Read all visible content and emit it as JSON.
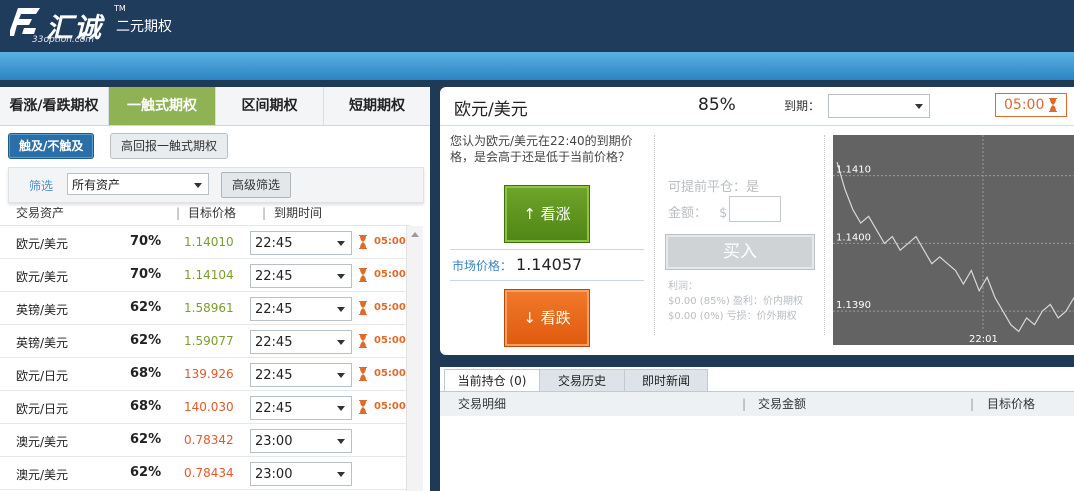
{
  "header": {
    "brand": "汇诚",
    "tm": "TM",
    "sub": "二元期权",
    "url": "33option.com"
  },
  "tabs": [
    "看涨/看跌期权",
    "一触式期权",
    "区间期权",
    "短期期权"
  ],
  "pills": {
    "active": "触及/不触及",
    "other": "高回报一触式期权"
  },
  "filter": {
    "label": "筛选",
    "value": "所有资产",
    "adv": "高级筛选"
  },
  "columns": {
    "asset": "交易资产",
    "target": "目标价格",
    "expiry": "到期时间"
  },
  "rows": [
    {
      "asset": "欧元/美元",
      "pct": "70%",
      "target": "1.14010",
      "color": "#7a9e2e",
      "time": "22:45",
      "countdown": "05:00"
    },
    {
      "asset": "欧元/美元",
      "pct": "70%",
      "target": "1.14104",
      "color": "#7a9e2e",
      "time": "22:45",
      "countdown": "05:00"
    },
    {
      "asset": "英镑/美元",
      "pct": "62%",
      "target": "1.58961",
      "color": "#7a9e2e",
      "time": "22:45",
      "countdown": "05:00"
    },
    {
      "asset": "英镑/美元",
      "pct": "62%",
      "target": "1.59077",
      "color": "#7a9e2e",
      "time": "22:45",
      "countdown": "05:00"
    },
    {
      "asset": "欧元/日元",
      "pct": "68%",
      "target": "139.926",
      "color": "#e0592a",
      "time": "22:45",
      "countdown": "05:00"
    },
    {
      "asset": "欧元/日元",
      "pct": "68%",
      "target": "140.030",
      "color": "#e0592a",
      "time": "22:45",
      "countdown": "05:00"
    },
    {
      "asset": "澳元/美元",
      "pct": "62%",
      "target": "0.78342",
      "color": "#e0592a",
      "time": "23:00",
      "countdown": ""
    },
    {
      "asset": "澳元/美元",
      "pct": "62%",
      "target": "0.78434",
      "color": "#e0592a",
      "time": "23:00",
      "countdown": ""
    }
  ],
  "trade": {
    "pair": "欧元/美元",
    "payout": "85%",
    "expiry_label": "到期：",
    "expiry_value": "",
    "timer": "05:00",
    "question": "您认为欧元/美元在22:40的到期价格，是会高于还是低于当前价格？",
    "up": "↑ 看涨",
    "down": "↓ 看跌",
    "market_label": "市场价格：",
    "market_value": "1.14057",
    "early_close": "可提前平仓：是",
    "amount_label": "金额：",
    "currency": "$",
    "buy": "买入",
    "profit_title": "利润：",
    "profit_in": "$0.00 (85%) 盈利：价内期权",
    "profit_out": "$0.00 (0%) 亏损：价外期权"
  },
  "chart_data": {
    "type": "line",
    "y_ticks": [
      "1.1410",
      "1.1400",
      "1.1390"
    ],
    "x_ticks": [
      "22:01"
    ],
    "ylim": [
      1.1385,
      1.1416
    ],
    "grid": true,
    "values": [
      1.1412,
      1.1408,
      1.1405,
      1.1403,
      1.1404,
      1.1402,
      1.14,
      1.1401,
      1.1399,
      1.14,
      1.1401,
      1.1399,
      1.1397,
      1.1398,
      1.1397,
      1.1396,
      1.1394,
      1.1396,
      1.1393,
      1.1395,
      1.1392,
      1.139,
      1.1388,
      1.1387,
      1.1389,
      1.1388,
      1.139,
      1.1391,
      1.1389,
      1.139,
      1.1392
    ]
  },
  "bottom": {
    "tabs": [
      "当前持仓 (0)",
      "交易历史",
      "即时新闻"
    ],
    "columns": [
      "交易明细",
      "交易金额",
      "目标价格"
    ]
  },
  "colors": {
    "header": "#1f3c5c",
    "accent_green": "#8fb354",
    "up": "#5a9220",
    "down": "#e8661a",
    "active_pill": "#2a6fa8"
  }
}
